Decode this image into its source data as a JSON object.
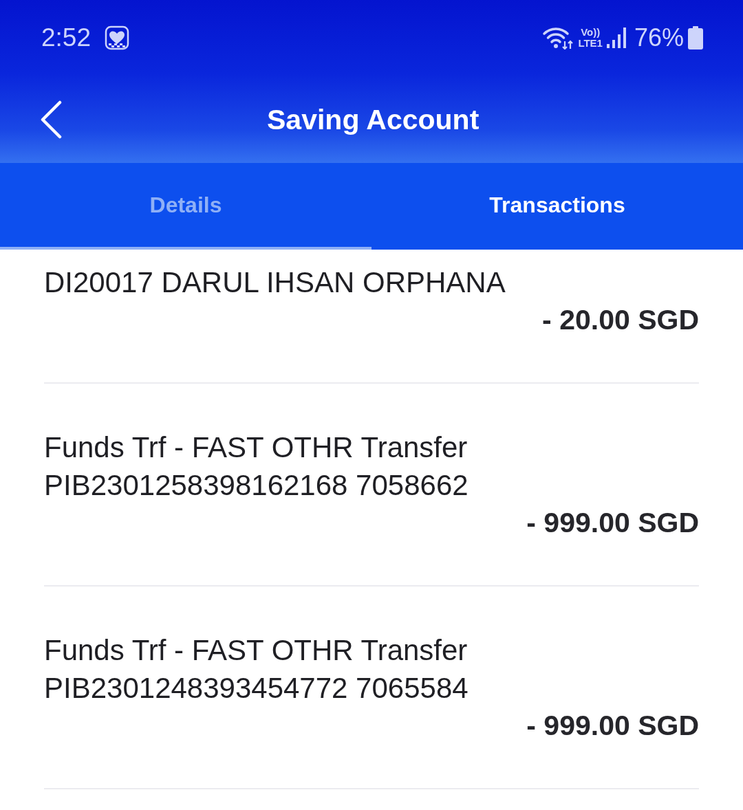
{
  "status_bar": {
    "time": "2:52",
    "volte_label": "Vo))",
    "lte_label": "LTE1",
    "battery": "76%"
  },
  "header": {
    "title": "Saving Account"
  },
  "tabs": [
    {
      "label": "Details",
      "selected": false
    },
    {
      "label": "Transactions",
      "selected": true
    }
  ],
  "transactions": [
    {
      "lines": [
        "DI20017 DARUL IHSAN ORPHANA"
      ],
      "amount": "- 20.00 SGD"
    },
    {
      "lines": [
        "Funds Trf - FAST OTHR Transfer",
        "PIB2301258398162168 7058662"
      ],
      "amount": "- 999.00 SGD"
    },
    {
      "lines": [
        "Funds Trf - FAST OTHR Transfer",
        "PIB2301248393454772 7065584"
      ],
      "amount": "- 999.00 SGD"
    }
  ]
}
